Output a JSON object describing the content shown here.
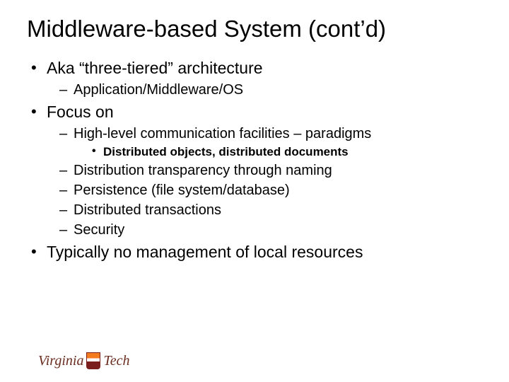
{
  "title": "Middleware-based System (cont’d)",
  "bullets": {
    "b1": "Aka “three-tiered” architecture",
    "b1_1": "Application/Middleware/OS",
    "b2": "Focus on",
    "b2_1": "High-level communication facilities – paradigms",
    "b2_1_1": "Distributed objects, distributed documents",
    "b2_2": "Distribution transparency through naming",
    "b2_3": "Persistence (file system/database)",
    "b2_4": "Distributed transactions",
    "b2_5": "Security",
    "b3": "Typically no management of local resources"
  },
  "logo": {
    "left": "Virginia",
    "right": "Tech"
  }
}
